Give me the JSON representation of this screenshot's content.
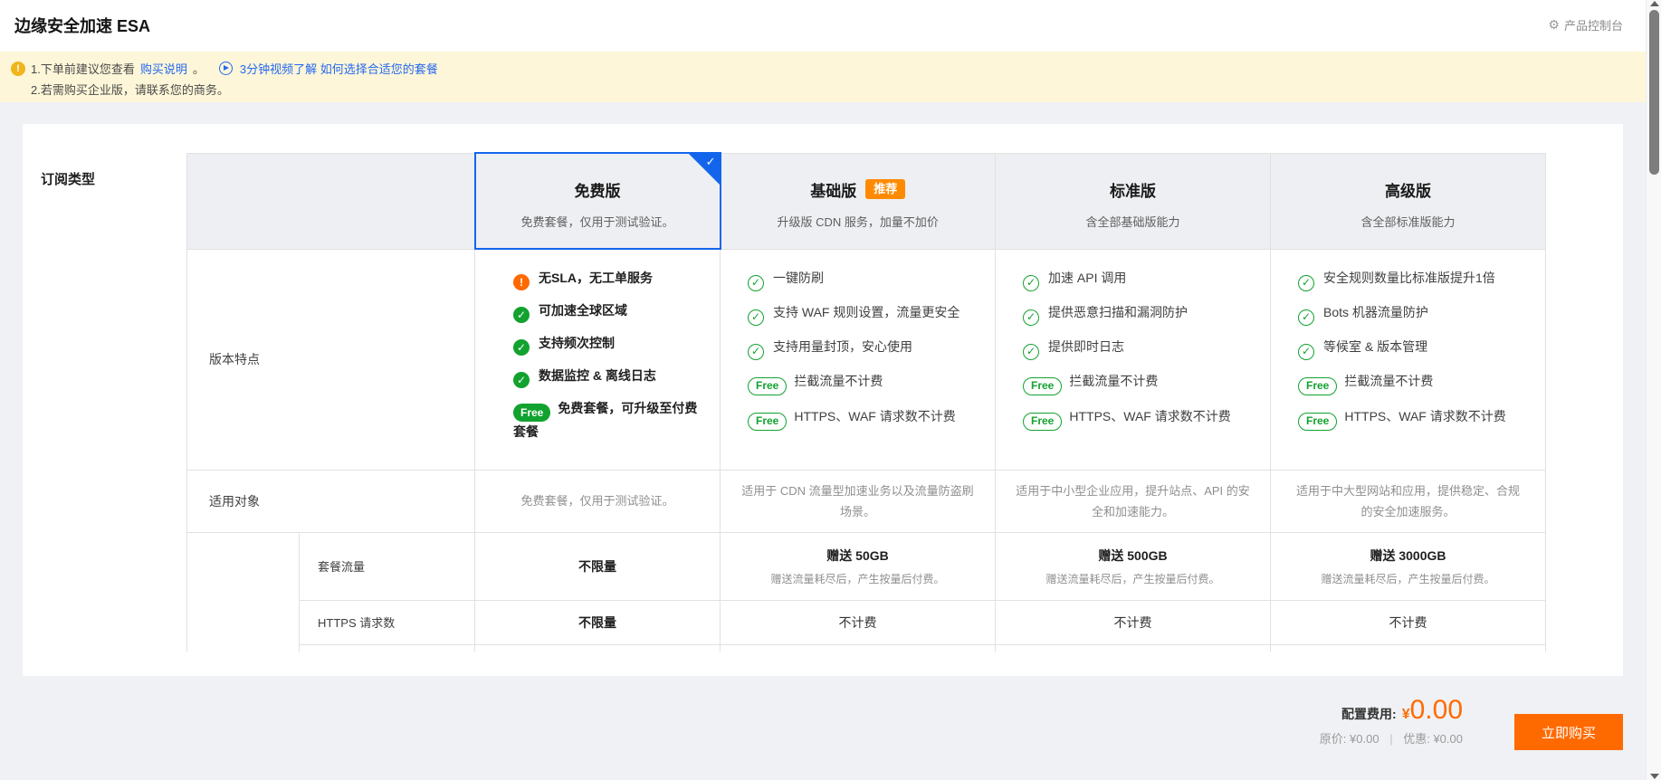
{
  "page": {
    "title": "边缘安全加速 ESA",
    "console_link": "产品控制台"
  },
  "notice": {
    "line1_prefix": "1.下单前建议您查看",
    "line1_link1": "购买说明",
    "line1_punct": "。",
    "line1_link2": "3分钟视频了解 如何选择合适您的套餐",
    "line2": "2.若需购买企业版，请联系您的商务。"
  },
  "subscription_label": "订阅类型",
  "table": {
    "row_labels": {
      "features": "版本特点",
      "audience": "适用对象",
      "traffic": "套餐流量",
      "https": "HTTPS 请求数"
    },
    "free_pill_label": "Free",
    "plans": [
      {
        "id": "free",
        "name": "免费版",
        "badge": null,
        "selected": true,
        "subtitle": "免费套餐，仅用于测试验证。",
        "features": [
          {
            "icon": "warning",
            "text": "无SLA，无工单服务"
          },
          {
            "icon": "check-filled",
            "text": "可加速全球区域"
          },
          {
            "icon": "check-filled",
            "text": "支持频次控制"
          },
          {
            "icon": "check-filled",
            "text": "数据监控 & 离线日志"
          },
          {
            "icon": "free-filled",
            "text": "免费套餐，可升级至付费套餐"
          }
        ],
        "audience": "免费套餐，仅用于测试验证。",
        "traffic_main": "不限量",
        "traffic_sub": "",
        "https": "不限量"
      },
      {
        "id": "basic",
        "name": "基础版",
        "badge": "推荐",
        "selected": false,
        "subtitle": "升级版 CDN 服务，加量不加价",
        "features": [
          {
            "icon": "check-outline",
            "text": "一键防刷"
          },
          {
            "icon": "check-outline",
            "text": "支持 WAF 规则设置，流量更安全"
          },
          {
            "icon": "check-outline",
            "text": "支持用量封顶，安心使用"
          },
          {
            "icon": "free-outline",
            "text": "拦截流量不计费"
          },
          {
            "icon": "free-outline",
            "text": "HTTPS、WAF 请求数不计费"
          }
        ],
        "audience": "适用于 CDN 流量型加速业务以及流量防盗刷场景。",
        "traffic_main": "赠送 50GB",
        "traffic_sub": "赠送流量耗尽后，产生按量后付费。",
        "https": "不计费"
      },
      {
        "id": "standard",
        "name": "标准版",
        "badge": null,
        "selected": false,
        "subtitle": "含全部基础版能力",
        "features": [
          {
            "icon": "check-outline",
            "text": "加速 API 调用"
          },
          {
            "icon": "check-outline",
            "text": "提供恶意扫描和漏洞防护"
          },
          {
            "icon": "check-outline",
            "text": "提供即时日志"
          },
          {
            "icon": "free-outline",
            "text": "拦截流量不计费"
          },
          {
            "icon": "free-outline",
            "text": "HTTPS、WAF 请求数不计费"
          }
        ],
        "audience": "适用于中小型企业应用，提升站点、API 的安全和加速能力。",
        "traffic_main": "赠送 500GB",
        "traffic_sub": "赠送流量耗尽后，产生按量后付费。",
        "https": "不计费"
      },
      {
        "id": "advanced",
        "name": "高级版",
        "badge": null,
        "selected": false,
        "subtitle": "含全部标准版能力",
        "features": [
          {
            "icon": "check-outline",
            "text": "安全规则数量比标准版提升1倍"
          },
          {
            "icon": "check-outline",
            "text": "Bots 机器流量防护"
          },
          {
            "icon": "check-outline",
            "text": "等候室 & 版本管理"
          },
          {
            "icon": "free-outline",
            "text": "拦截流量不计费"
          },
          {
            "icon": "free-outline",
            "text": "HTTPS、WAF 请求数不计费"
          }
        ],
        "audience": "适用于中大型网站和应用，提供稳定、合规的安全加速服务。",
        "traffic_main": "赠送 3000GB",
        "traffic_sub": "赠送流量耗尽后，产生按量后付费。",
        "https": "不计费"
      }
    ]
  },
  "footer": {
    "config_fee_label": "配置费用:",
    "currency": "¥",
    "amount": "0.00",
    "original_label": "原价:",
    "original_value": "¥0.00",
    "separator": "|",
    "discount_label": "优惠:",
    "discount_value": "¥0.00",
    "buy_button": "立即购买"
  },
  "colors": {
    "accent_blue": "#1366ec",
    "link_blue": "#2468f2",
    "brand_orange": "#ff6a00",
    "badge_orange": "#ff8a00",
    "success_green": "#12a22f",
    "notice_bg": "#fdf6d8",
    "warning_yellow": "#f0b41c"
  }
}
